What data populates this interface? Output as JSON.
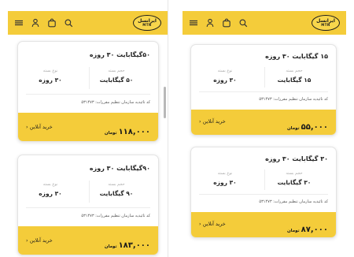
{
  "brand": {
    "logo_text": "ایرانسل",
    "logo_sub": "MTN"
  },
  "colors": {
    "accent": "#f4cc3a",
    "text": "#222222",
    "muted": "#a9a9a9"
  },
  "icons": [
    "menu-icon",
    "user-icon",
    "shopping-bag-icon",
    "search-icon"
  ],
  "labels": {
    "package_size": "حجم بسته",
    "package_type": "نوع بسته",
    "approval_code": "کد تائیدیه سازمان تنظیم مقررات: ۵۳۱۴۷۳",
    "currency": "تومان",
    "buy_online": "خرید آنلاین"
  },
  "left_screen": {
    "cards": [
      {
        "title": "۵۰گیگابایت ۳۰ روزه",
        "size": "۵۰ گیگابایت",
        "type": "۳۰ روزه",
        "price": "۱۱۸,۰۰۰"
      },
      {
        "title": "۹۰گیگابایت ۳۰ روزه",
        "size": "۹۰ گیگابایت",
        "type": "۳۰ روزه",
        "price": "۱۸۳,۰۰۰"
      }
    ]
  },
  "right_screen": {
    "cards": [
      {
        "title": "۱۵ گیگابایت ۳۰ روزه",
        "size": "۱۵ گیگابایت",
        "type": "۳۰ روزه",
        "price": "۵۵,۰۰۰"
      },
      {
        "title": "۳۰ گیگابایت ۳۰ روزه",
        "size": "۳۰ گیگابایت",
        "type": "۳۰ روزه",
        "price": "۸۷,۰۰۰"
      }
    ]
  }
}
